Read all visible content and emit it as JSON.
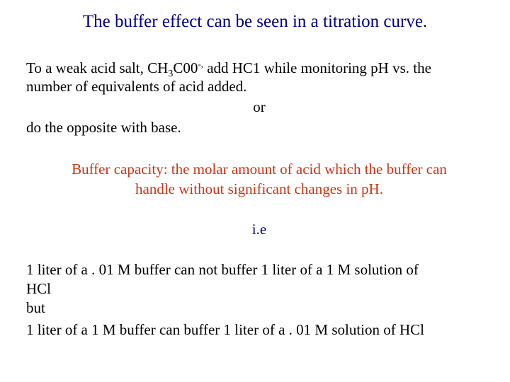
{
  "slide": {
    "title": "The buffer effect can be seen in a titration curve.",
    "intro": {
      "line1_before_formula": "To a weak acid salt, ",
      "formula_part1": "CH",
      "formula_sub": "3",
      "formula_part2": "C00",
      "formula_sup": "-,",
      "line1_after_formula": " add HC1 while monitoring pH vs. the",
      "line2": "number of equivalents of acid added.",
      "or": "or",
      "line3": "do the opposite with base."
    },
    "definition": {
      "line1": "Buffer capacity: the molar amount of acid which the buffer can",
      "line2": "handle without significant changes in pH."
    },
    "ie": "i.e",
    "examples": {
      "line1": "1 liter of a . 01 M buffer can not buffer 1 liter of a 1 M solution of",
      "line2": "HCl",
      "line3": "but",
      "line4": "1 liter of a  1 M buffer can buffer 1 liter of a . 01 M solution of HCl"
    }
  },
  "colors": {
    "title": "#000080",
    "definition": "#cc3311",
    "body": "#000000",
    "background": "#ffffff"
  }
}
